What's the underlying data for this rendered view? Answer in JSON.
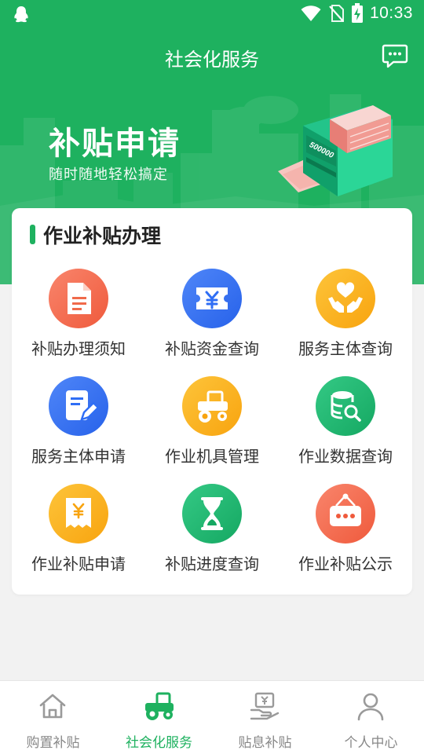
{
  "status_bar": {
    "time": "10:33"
  },
  "header": {
    "title": "社会化服务"
  },
  "banner": {
    "title": "补贴申请",
    "subtitle": "随时随地轻松搞定",
    "machine_counter": "500000"
  },
  "card": {
    "title": "作业补贴办理",
    "items": [
      {
        "label": "补贴办理须知",
        "icon": "document-icon",
        "color": "#f56a4a"
      },
      {
        "label": "补贴资金查询",
        "icon": "yuan-ticket-icon",
        "color": "#2f6ef5"
      },
      {
        "label": "服务主体查询",
        "icon": "heart-hands-icon",
        "color": "#fbb21c"
      },
      {
        "label": "服务主体申请",
        "icon": "edit-form-icon",
        "color": "#2f6ef5"
      },
      {
        "label": "作业机具管理",
        "icon": "tractor-icon",
        "color": "#fbb21c"
      },
      {
        "label": "作业数据查询",
        "icon": "database-search-icon",
        "color": "#1eb572"
      },
      {
        "label": "作业补贴申请",
        "icon": "yuan-receipt-icon",
        "color": "#fbb21c"
      },
      {
        "label": "补贴进度查询",
        "icon": "hourglass-icon",
        "color": "#1eb572"
      },
      {
        "label": "作业补贴公示",
        "icon": "notice-board-icon",
        "color": "#f56a4a"
      }
    ]
  },
  "bottom_nav": {
    "items": [
      {
        "label": "购置补贴",
        "icon": "home-icon",
        "active": false
      },
      {
        "label": "社会化服务",
        "icon": "tractor-icon",
        "active": true
      },
      {
        "label": "贴息补贴",
        "icon": "yuan-hand-icon",
        "active": false
      },
      {
        "label": "个人中心",
        "icon": "user-icon",
        "active": false
      }
    ]
  },
  "colors": {
    "primary": "#1eb15f",
    "background": "#f2f2f2"
  }
}
